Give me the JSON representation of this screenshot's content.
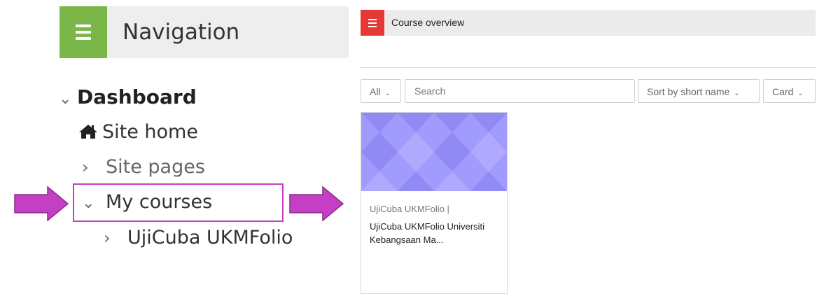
{
  "navigation": {
    "title": "Navigation",
    "items": [
      {
        "label": "Dashboard",
        "chevron": "⌄"
      },
      {
        "label": "Site home",
        "icon": "home-icon"
      },
      {
        "label": "Site pages",
        "chevron": "›"
      },
      {
        "label": "My courses",
        "chevron": "⌄"
      },
      {
        "label": "UjiCuba UKMFolio",
        "chevron": "›"
      }
    ]
  },
  "course_overview": {
    "title": "Course overview",
    "filter_label": "All",
    "search_placeholder": "Search",
    "sort_label": "Sort by short name",
    "view_label": "Card",
    "courses": [
      {
        "category": "UjiCuba UKMFolio |",
        "name": "UjiCuba UKMFolio Universiti Kebangsaan Ma..."
      }
    ]
  },
  "colors": {
    "nav_accent": "#7ab648",
    "overview_accent": "#e53935",
    "arrow": "#c43fc4",
    "card_image": "#a29bfe"
  }
}
